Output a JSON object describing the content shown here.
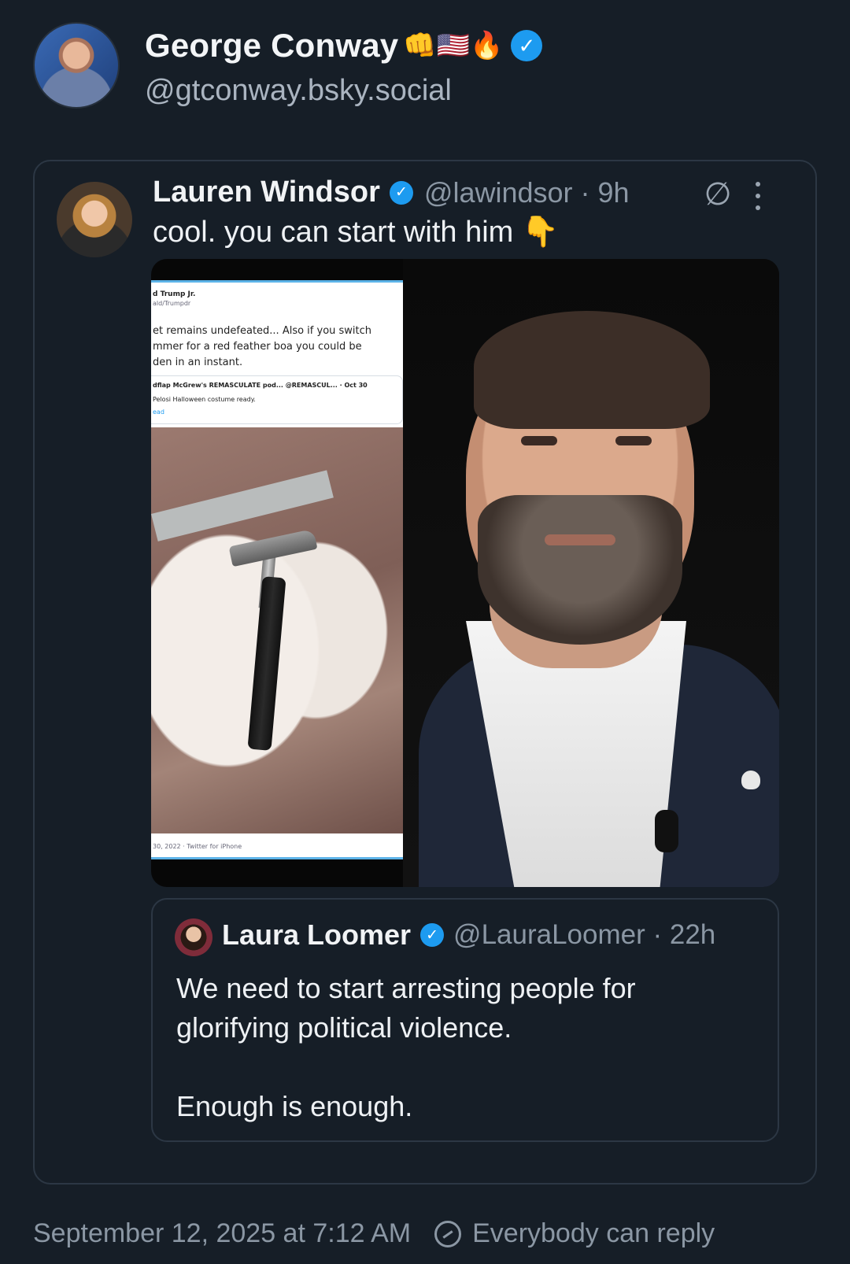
{
  "post": {
    "author_name": "George Conway",
    "author_emojis": "👊🇺🇸🔥",
    "author_handle": "@gtconway.bsky.social",
    "timestamp": "September 12, 2025 at 7:12 AM",
    "reply_setting": "Everybody can reply"
  },
  "embed": {
    "author_name": "Lauren Windsor",
    "handle_time": "@lawindsor · 9h",
    "text": "cool. you can start with him 👇",
    "image": {
      "screenshot_lines": [
        "d Trump Jr.",
        "ald/Trumpdr",
        "et remains undefeated... Also if you switch",
        "mmer for a red feather boa you could be",
        "den in an instant.",
        "dflap McGrew's REMASCULATE pod...  @REMASCUL...  · Oct 30",
        "Pelosi Halloween costume ready.",
        "ead",
        "30, 2022 · Twitter for iPhone"
      ]
    },
    "quote": {
      "author_name": "Laura Loomer",
      "handle_time": "@LauraLoomer · 22h",
      "text_line1": "We need to start arresting people for",
      "text_line2": "glorifying political violence.",
      "text_line3": "Enough is enough."
    }
  },
  "icons": {
    "verified": "verified-badge-icon",
    "no_circle": "empty-set-icon",
    "more": "vertical-ellipsis-icon",
    "reply": "reply-restriction-icon"
  },
  "colors": {
    "background": "#161e27",
    "verified": "#1d9bf0",
    "muted_text": "#8b97a4"
  }
}
